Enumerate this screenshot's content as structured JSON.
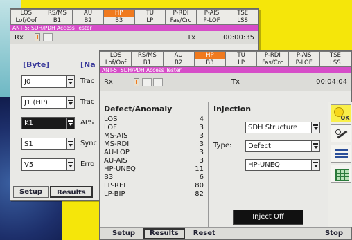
{
  "back_window": {
    "alarms_row1": [
      "LOS",
      "RS/MS",
      "AU",
      "HP",
      "TU",
      "P-RDI",
      "P-AIS",
      "TSE"
    ],
    "alarms_row2": [
      "Lof/Oof",
      "B1",
      "B2",
      "B3",
      "LP",
      "Fas/Crc",
      "P-LOF",
      "LSS"
    ],
    "alarm_active_index_row1": 3,
    "title": "ANT-5: SDH/PDH Access Tester",
    "status_label": "Rx",
    "tx_label": "Tx",
    "time": "00:00:35",
    "byte_header": "[Byte]",
    "name_header": "[Na",
    "bytes": [
      "J0",
      "J1 (HP)",
      "K1",
      "S1",
      "V5"
    ],
    "selected_byte_index": 2,
    "names": [
      "Trac",
      "Trac",
      "APS",
      "Sync",
      "Erro"
    ],
    "tabs": [
      "Setup",
      "Results"
    ]
  },
  "front_window": {
    "alarms_row1": [
      "LOS",
      "RS/MS",
      "AU",
      "HP",
      "TU",
      "P-RDI",
      "P-AIS",
      "TSE"
    ],
    "alarms_row2": [
      "Lof/Oof",
      "B1",
      "B2",
      "B3",
      "LP",
      "Fas/Crc",
      "P-LOF",
      "LSS"
    ],
    "alarm_active_index_row1": 3,
    "title": "ANT-5: SDH/PDH Access Tester",
    "status_label": "Rx",
    "tx_label": "Tx",
    "time": "00:04:04",
    "defect_header": "Defect/Anomaly",
    "defects": [
      {
        "name": "LOS",
        "count": "4"
      },
      {
        "name": "LOF",
        "count": "3"
      },
      {
        "name": "MS-AIS",
        "count": "3"
      },
      {
        "name": "MS-RDI",
        "count": "3"
      },
      {
        "name": "AU-LOP",
        "count": "3"
      },
      {
        "name": "AU-AIS",
        "count": "3"
      },
      {
        "name": "HP-UNEQ",
        "count": "11"
      },
      {
        "name": "B3",
        "count": "6"
      },
      {
        "name": "LP-REI",
        "count": "80"
      },
      {
        "name": "LP-BIP",
        "count": "82"
      }
    ],
    "injection_header": "Injection",
    "structure_value": "SDH Structure",
    "type_label": "Type:",
    "type_value": "Defect",
    "defect_value": "HP-UNEQ",
    "inject_button": "Inject Off",
    "ok_label": "OK",
    "bottom_tabs": [
      "Setup",
      "Results",
      "Reset"
    ],
    "stop_label": "Stop"
  },
  "colors": {
    "alarm_active": "#f07a1e",
    "title_bar": "#d64dc8",
    "background": "#f5e60a"
  }
}
